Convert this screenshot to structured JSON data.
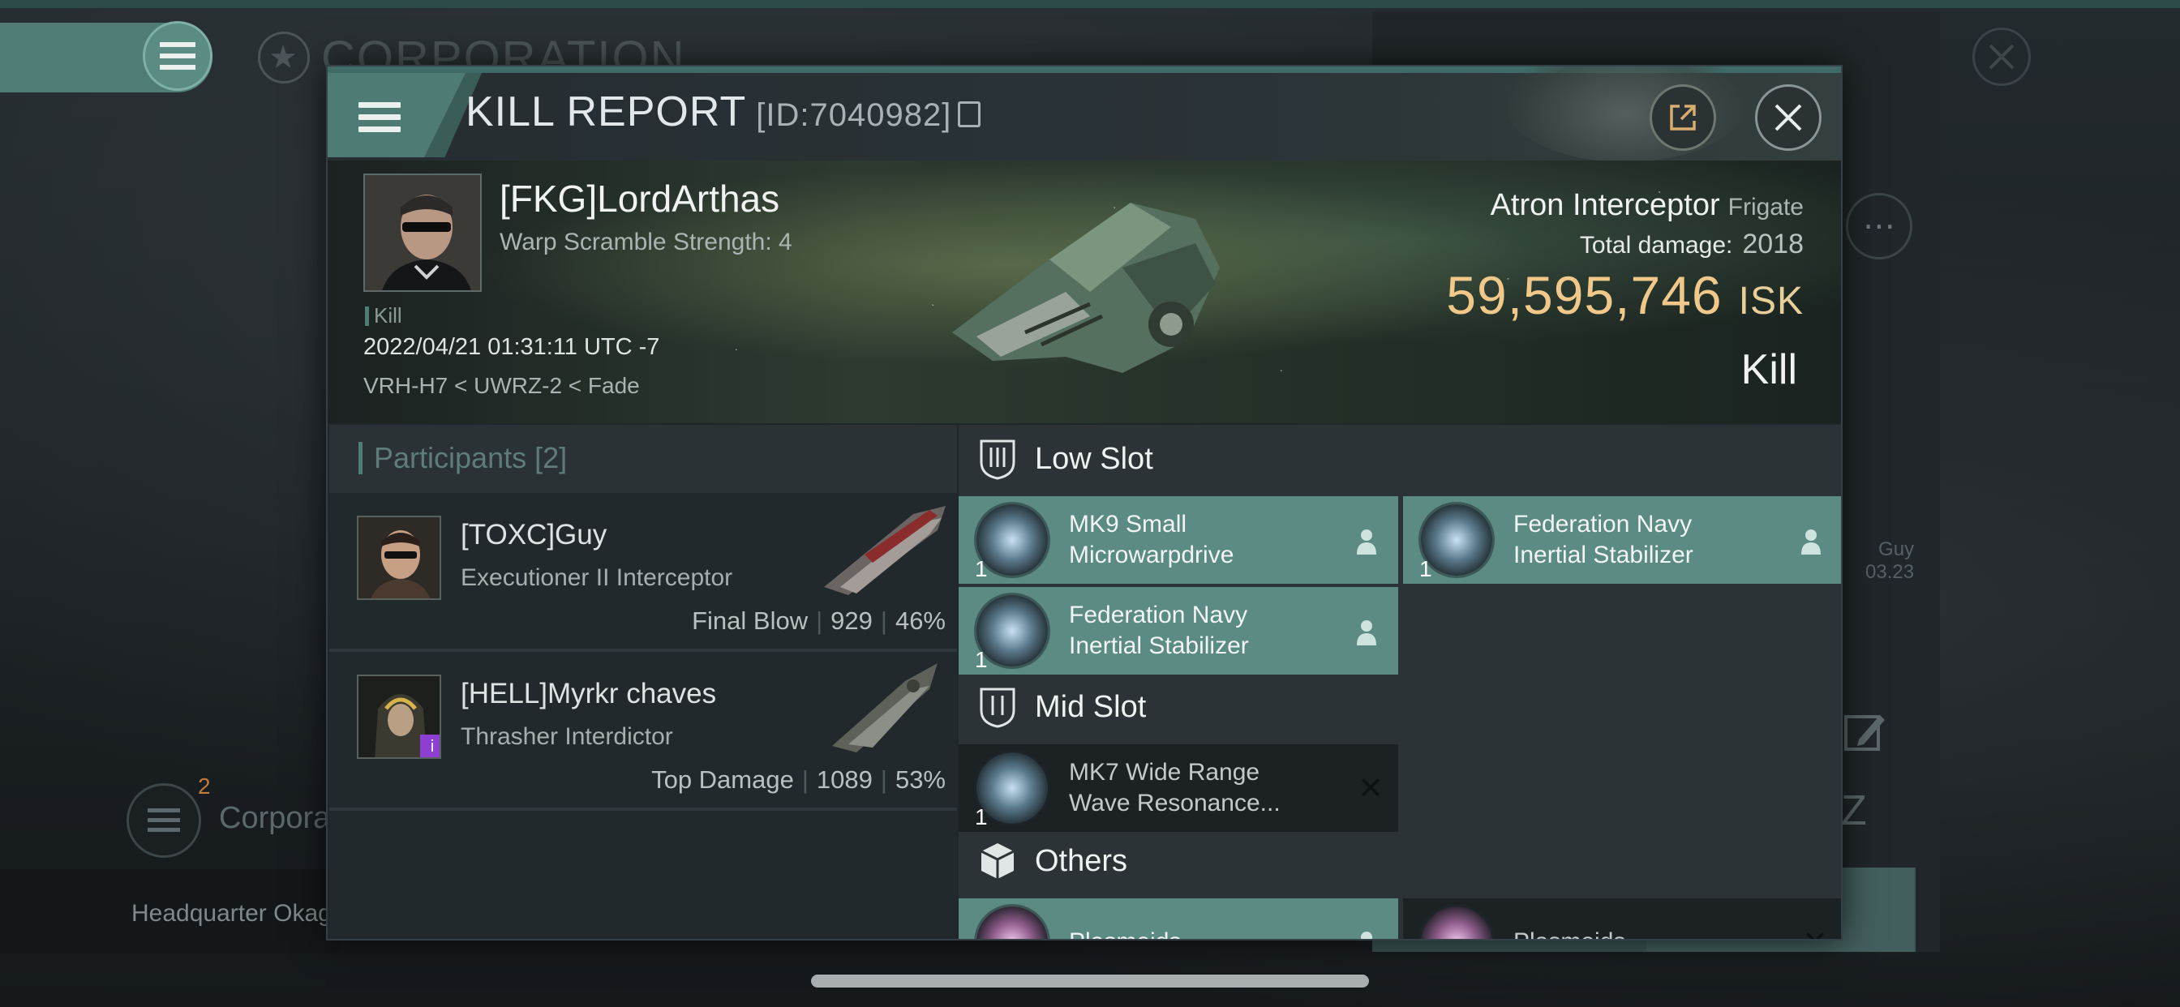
{
  "background": {
    "corp_title": "CORPORATION",
    "corp_label": "Corpora",
    "corp_badge": "2",
    "headquarter": "Headquarter Okag",
    "right_name": "Guy",
    "right_date": "03.23"
  },
  "modal": {
    "title": "KILL REPORT",
    "id": "[ID:7040982]"
  },
  "victim": {
    "name": "[FKG]LordArthas",
    "subtitle": "Warp Scramble Strength: 4",
    "tag": "Kill",
    "date": "2022/04/21 01:31:11 UTC -7",
    "location": "VRH-H7 < UWRZ-2 < Fade",
    "ship_name": "Atron Interceptor",
    "ship_class": "Frigate",
    "total_damage_label": "Total damage:",
    "total_damage_value": "2018",
    "isk_value": "59,595,746",
    "isk_unit": "ISK",
    "result": "Kill"
  },
  "participants": {
    "title": "Participants [2]",
    "rows": [
      {
        "name": "[TOXC]Guy",
        "ship": "Executioner II Interceptor",
        "stat_label": "Final Blow",
        "damage": "929",
        "percent": "46%"
      },
      {
        "name": "[HELL]Myrkr chaves",
        "ship": "Thrasher Interdictor",
        "stat_label": "Top Damage",
        "damage": "1089",
        "percent": "53%"
      }
    ]
  },
  "fitting": {
    "low_slot": {
      "title": "Low Slot",
      "modules": [
        {
          "name_line1": "MK9 Small",
          "name_line2": "Microwarpdrive",
          "qty": "1",
          "state": "dropped"
        },
        {
          "name_line1": "Federation Navy",
          "name_line2": "Inertial Stabilizer",
          "qty": "1",
          "state": "dropped"
        },
        {
          "name_line1": "Federation Navy",
          "name_line2": "Inertial Stabilizer",
          "qty": "1",
          "state": "dropped"
        }
      ]
    },
    "mid_slot": {
      "title": "Mid Slot",
      "modules": [
        {
          "name_line1": "MK7 Wide Range",
          "name_line2": "Wave Resonance...",
          "qty": "1",
          "state": "destroyed"
        }
      ]
    },
    "others": {
      "title": "Others",
      "modules": [
        {
          "name_line1": "Plasmoids",
          "state": "dropped"
        },
        {
          "name_line1": "Plasmoids",
          "state": "destroyed"
        }
      ]
    }
  },
  "colors": {
    "accent": "#4f7c74",
    "dropped_bg": "#5b8b83",
    "destroyed_bg": "#1c2224",
    "isk": "#f0c98a"
  }
}
